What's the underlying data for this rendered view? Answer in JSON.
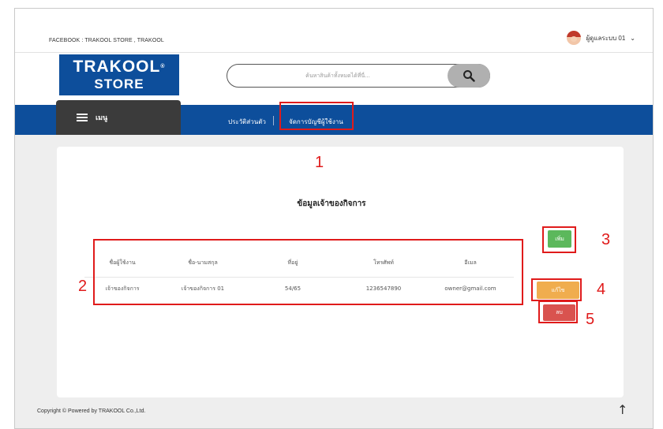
{
  "topbar": {
    "facebook_text": "FACEBOOK : TRAKOOL STORE , TRAKOOL",
    "user_name": "ผู้ดูแลระบบ 01",
    "user_caret": "⌄"
  },
  "logo": {
    "line1": "TRAKOOL",
    "line2": "STORE",
    "mark": "®"
  },
  "search": {
    "placeholder": "ค้นหาสินค้าทั้งหมดได้ที่นี่..."
  },
  "nav": {
    "menu_label": "เมนู",
    "profile_label": "ประวัติส่วนตัว",
    "accounts_label": "จัดการบัญชีผู้ใช้งาน"
  },
  "main": {
    "title": "ข้อมูลเจ้าของกิจการ",
    "columns": [
      "ชื่อผู้ใช้งาน",
      "ชื่อ-นามสกุล",
      "ที่อยู่",
      "โทรศัพท์",
      "อีเมล"
    ],
    "rows": [
      [
        "เจ้าของกิจการ",
        "เจ้าของกิจการ 01",
        "54/65",
        "1236547890",
        "owner@gmail.com"
      ]
    ],
    "add_label": "เพิ่ม",
    "edit_label": "แก้ไข",
    "delete_label": "ลบ"
  },
  "footer": {
    "copyright": "Copyright © Powered by TRAKOOL Co.,Ltd.",
    "up_arrow": "↑"
  },
  "annotations": [
    "1",
    "2",
    "3",
    "4",
    "5"
  ],
  "colors": {
    "brand_blue": "#0d4e9b",
    "add_green": "#5cb85c",
    "edit_orange": "#f0ad4e",
    "delete_red": "#d9534f",
    "annotation_red": "#e01b1b"
  }
}
